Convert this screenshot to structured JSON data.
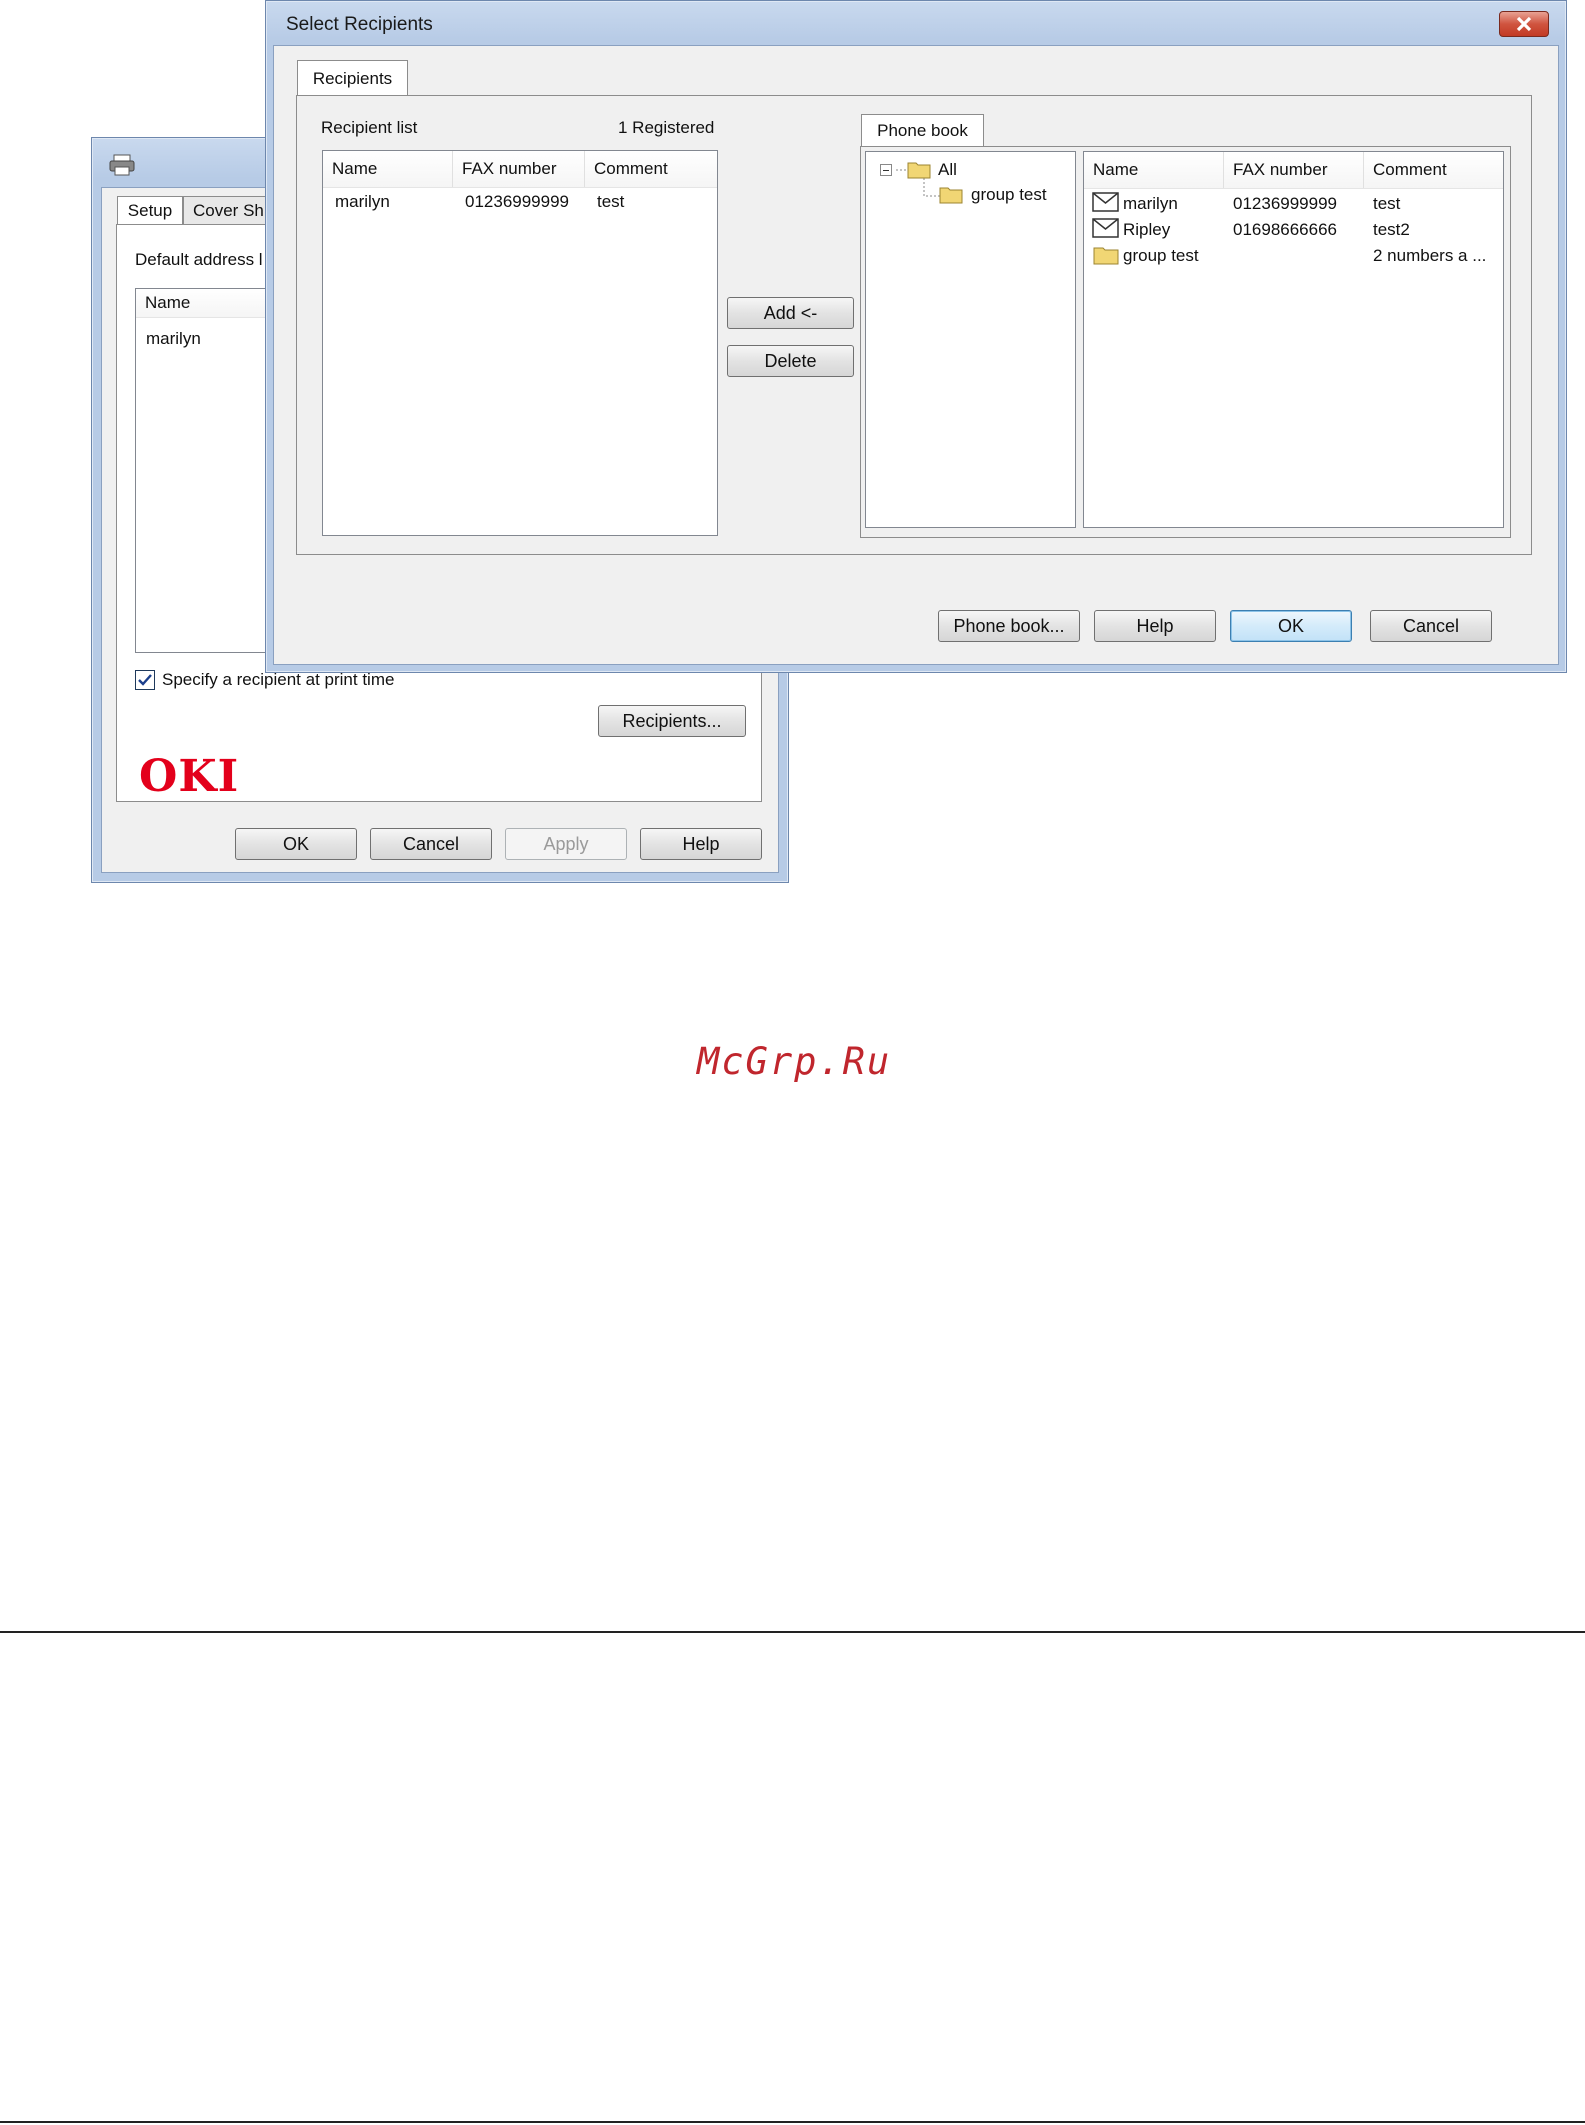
{
  "back_dialog": {
    "tabs": [
      "Setup",
      "Cover Sh"
    ],
    "default_address_label": "Default address l",
    "list_header_name": "Name",
    "list_row_name": "marilyn",
    "specify_checkbox_label": "Specify a recipient at print time",
    "specify_checked": true,
    "recipients_button": "Recipients...",
    "logo_text": "OKI",
    "buttons": {
      "ok": "OK",
      "cancel": "Cancel",
      "apply": "Apply",
      "help": "Help"
    }
  },
  "select_dialog": {
    "title": "Select Recipients",
    "close_icon": "close-icon",
    "tab_label": "Recipients",
    "recipient_list_label": "Recipient list",
    "registered_count": "1 Registered",
    "recipient_columns": [
      "Name",
      "FAX number",
      "Comment"
    ],
    "recipient_rows": [
      {
        "name": "marilyn",
        "fax": "01236999999",
        "comment": "test"
      }
    ],
    "add_button": "Add <-",
    "delete_button": "Delete",
    "phonebook_tab": "Phone book",
    "tree": {
      "root": "All",
      "child": "group test"
    },
    "phonebook_columns": [
      "Name",
      "FAX number",
      "Comment"
    ],
    "phonebook_rows": [
      {
        "icon": "envelope-icon",
        "name": "marilyn",
        "fax": "01236999999",
        "comment": "test"
      },
      {
        "icon": "envelope-icon",
        "name": "Ripley",
        "fax": "01698666666",
        "comment": "test2"
      },
      {
        "icon": "folder-icon",
        "name": "group test",
        "fax": "",
        "comment": "2 numbers a ..."
      }
    ],
    "buttons": {
      "phone_book": "Phone book...",
      "help": "Help",
      "ok": "OK",
      "cancel": "Cancel"
    }
  },
  "watermark": "McGrp.Ru",
  "colors": {
    "oki_red": "#e3001b",
    "watermark_red": "#c0262d",
    "title_bar": "#b9cde8",
    "close_red": "#c8402e"
  }
}
